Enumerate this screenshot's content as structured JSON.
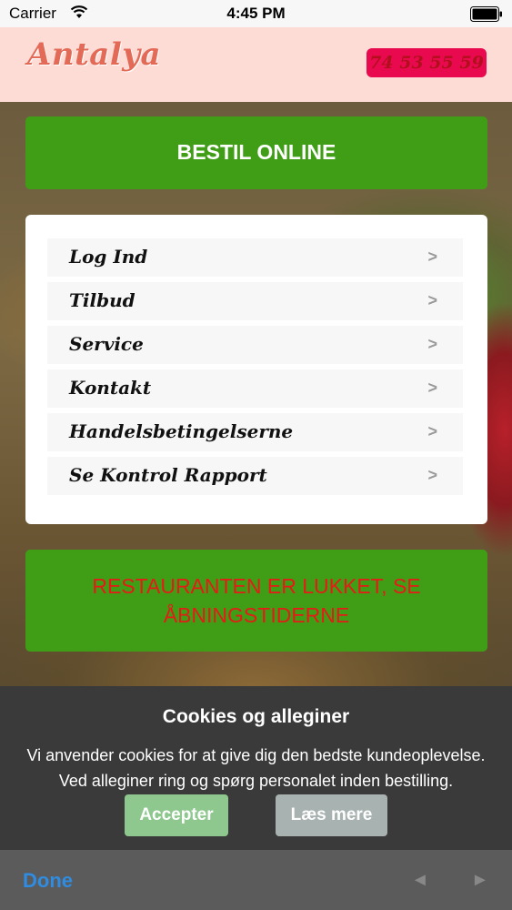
{
  "status_bar": {
    "carrier": "Carrier",
    "time": "4:45 PM",
    "wifi_icon": "wifi-icon",
    "battery_icon": "battery-icon"
  },
  "header": {
    "logo": "Antalya",
    "phone": "74 53 55 59"
  },
  "order_button": "BESTIL ONLINE",
  "menu": {
    "items": [
      {
        "label": "Log Ind",
        "chevron": ">"
      },
      {
        "label": "Tilbud",
        "chevron": ">"
      },
      {
        "label": "Service",
        "chevron": ">"
      },
      {
        "label": "Kontakt",
        "chevron": ">"
      },
      {
        "label": "Handelsbetingelserne",
        "chevron": ">"
      },
      {
        "label": "Se Kontrol Rapport",
        "chevron": ">"
      }
    ]
  },
  "closed_notice": {
    "line1": "RESTAURANTEN ER LUKKET, SE",
    "line2": "ÅBNINGSTIDERNE"
  },
  "cookie_banner": {
    "title": "Cookies og alleginer",
    "line1": "Vi anvender cookies for at give dig den bedste kundeoplevelse.",
    "line2": "Ved alleginer ring og spørg personalet inden bestilling.",
    "accept": "Accepter",
    "more": "Læs mere"
  },
  "toolbar": {
    "done": "Done",
    "prev": "◄",
    "next": "►"
  },
  "colors": {
    "header_bg": "#fddcd6",
    "green_button": "#3f9d16",
    "phone_button": "#e9094f",
    "closed_text": "#e61b17",
    "done_blue": "#2f8ce0"
  }
}
